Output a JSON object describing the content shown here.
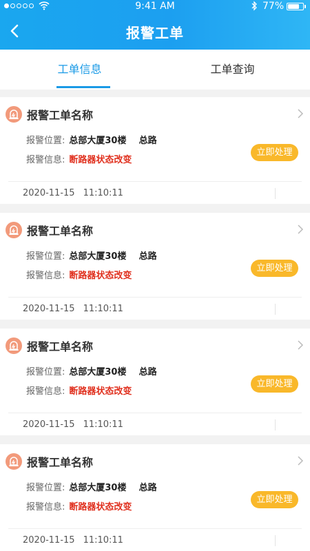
{
  "status_bar": {
    "time": "9:41 AM",
    "battery_percent": "77%",
    "battery_level": 0.77,
    "signal_bars": 1,
    "icons": [
      "signal-dots-icon",
      "wifi-icon",
      "bluetooth-icon",
      "battery-icon"
    ]
  },
  "header": {
    "title": "报警工单",
    "back_icon": "chevron-left-icon",
    "background_color": "#1ca3ee"
  },
  "tabs": [
    {
      "label": "工单信息",
      "active": true
    },
    {
      "label": "工单查询",
      "active": false
    }
  ],
  "accent_color": "#1a9ae6",
  "alert_color": "#e0301e",
  "button_color": "#f9b82a",
  "cards": [
    {
      "title": "报警工单名称",
      "location_label": "报警位置:",
      "location": "总部大厦30楼    总路",
      "info_label": "报警信息:",
      "info": "断路器状态改变",
      "action": "立即处理",
      "date": "2020-11-15",
      "time": "11:10:11"
    },
    {
      "title": "报警工单名称",
      "location_label": "报警位置:",
      "location": "总部大厦30楼    总路",
      "info_label": "报警信息:",
      "info": "断路器状态改变",
      "action": "立即处理",
      "date": "2020-11-15",
      "time": "11:10:11"
    },
    {
      "title": "报警工单名称",
      "location_label": "报警位置:",
      "location": "总部大厦30楼    总路",
      "info_label": "报警信息:",
      "info": "断路器状态改变",
      "action": "立即处理",
      "date": "2020-11-15",
      "time": "11:10:11"
    },
    {
      "title": "报警工单名称",
      "location_label": "报警位置:",
      "location": "总部大厦30楼    总路",
      "info_label": "报警信息:",
      "info": "断路器状态改变",
      "action": "立即处理",
      "date": "2020-11-15",
      "time": "11:10:11"
    }
  ]
}
